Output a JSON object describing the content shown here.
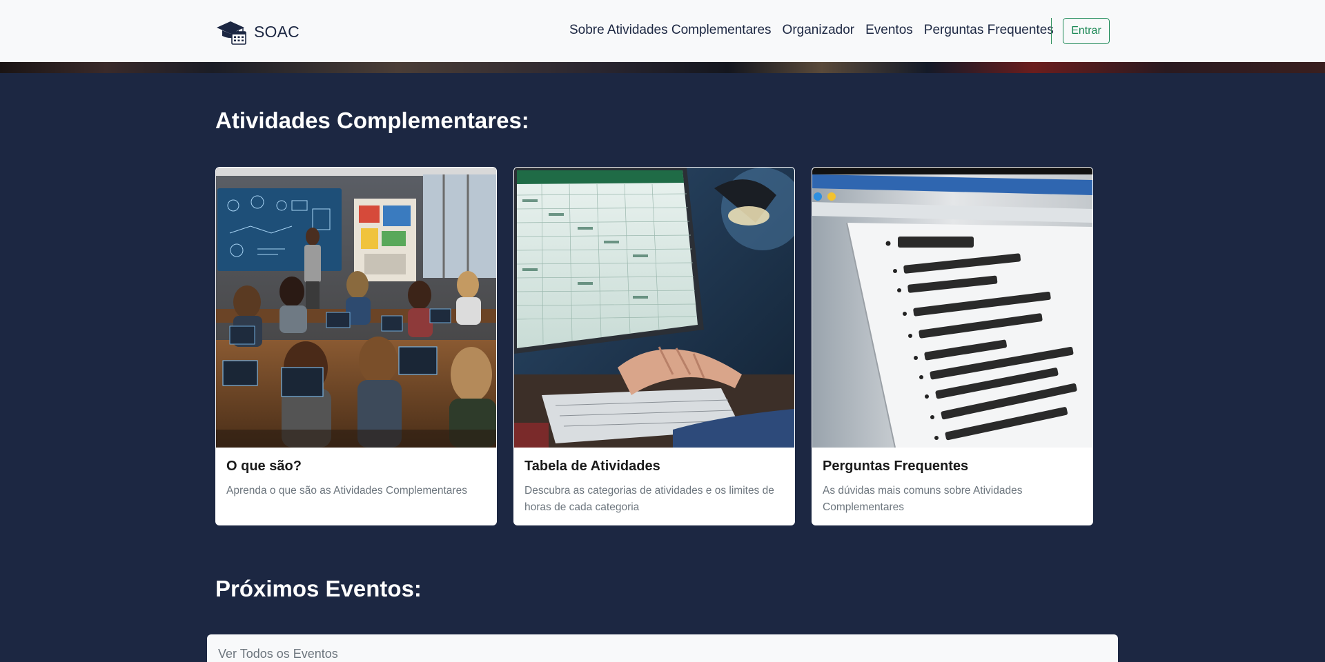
{
  "navbar": {
    "brand": "SOAC",
    "brand_icon": "graduation-cap-calendar-icon",
    "links": [
      "Sobre Atividades Complementares",
      "Organizador",
      "Eventos",
      "Perguntas Frequentes"
    ],
    "login_label": "Entrar"
  },
  "colors": {
    "navbar_bg": "#f8f9fa",
    "page_bg": "#1c2742",
    "brand_text": "#1c2742",
    "login_accent": "#198754",
    "card_bg": "#ffffff",
    "card_text_muted": "#6c757d"
  },
  "sections": {
    "activities_title": "Atividades Complementares:",
    "events_title": "Próximos Eventos:"
  },
  "cards": [
    {
      "title": "O que são?",
      "text": "Aprenda o que são as Atividades Complementares",
      "image": "classroom-students-laptops-photo"
    },
    {
      "title": "Tabela de Atividades",
      "text": "Descubra as categorias de atividades e os limites de horas de cada categoria",
      "image": "spreadsheet-on-monitor-photo"
    },
    {
      "title": "Perguntas Frequentes",
      "text": "As dúvidas mais comuns sobre Atividades Complementares",
      "image": "questions-list-screen-photo"
    }
  ],
  "events": {
    "panel_text": "Ver Todos os Eventos"
  }
}
